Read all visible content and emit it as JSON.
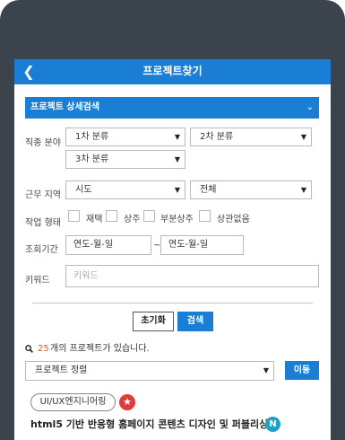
{
  "header": {
    "title": "프로젝트찾기",
    "back_icon": "chevron-left-icon"
  },
  "panel": {
    "label": "프로젝트 상세검색",
    "toggle_icon": "chevron-down-icon"
  },
  "job_field": {
    "label": "직종 분야",
    "primary": "1차 분류",
    "secondary": "2차 분류",
    "tertiary": "3차 분류"
  },
  "work_region": {
    "label": "근무 지역",
    "city": "시도",
    "district": "전체"
  },
  "work_type": {
    "label": "작업 형태",
    "options": [
      "재택",
      "상주",
      "부분상주",
      "상관없음"
    ]
  },
  "period": {
    "label": "조회기간",
    "start_placeholder": "연도-월-일",
    "separator": "~",
    "end_placeholder": "연도-월-일"
  },
  "keyword": {
    "label": "키워드",
    "placeholder": "키워드"
  },
  "actions": {
    "reset": "초기화",
    "search": "검색"
  },
  "results": {
    "count": "25",
    "suffix": "개의 프로젝트가 있습니다."
  },
  "sort": {
    "selected": "프로젝트 정렬",
    "move": "이동"
  },
  "project": {
    "tag": "UI/UX엔지니어링",
    "tag_icon": "star-icon",
    "title": "html5 기반 반응형 홈페이지 콘텐츠 디자인 및 퍼블리싱",
    "badge": "N"
  },
  "colors": {
    "accent": "#1a7fd4",
    "count": "#e05a1a",
    "star": "#e03b3b",
    "new": "#1fa0c9"
  }
}
